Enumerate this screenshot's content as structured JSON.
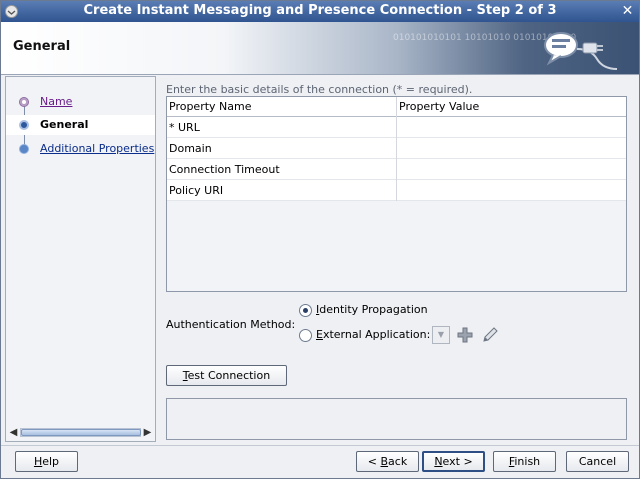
{
  "window": {
    "title": "Create Instant Messaging and Presence Connection - Step 2 of 3",
    "close_glyph": "✕"
  },
  "banner": {
    "heading": "General",
    "decoration_text": "010101010101 10101010 01010101010"
  },
  "nav": {
    "items": [
      {
        "label": "Name",
        "state": "visited"
      },
      {
        "label": "General",
        "state": "current"
      },
      {
        "label": "Additional Properties",
        "state": "link"
      }
    ]
  },
  "main": {
    "intro": "Enter the basic details of the connection (* = required).",
    "table": {
      "columns": [
        "Property Name",
        "Property Value"
      ],
      "rows": [
        {
          "name": "* URL",
          "value": ""
        },
        {
          "name": "Domain",
          "value": ""
        },
        {
          "name": "Connection Timeout",
          "value": ""
        },
        {
          "name": "Policy URI",
          "value": ""
        }
      ]
    },
    "auth": {
      "label": "Authentication Method:",
      "options": [
        {
          "label": "Identity Propagation",
          "mnemonic": "I",
          "rest": "dentity Propagation",
          "selected": true
        },
        {
          "label": "External Application:",
          "mnemonic": "E",
          "rest": "xternal Application:",
          "selected": false
        }
      ],
      "combo_value": ""
    },
    "test_button": {
      "mnemonic": "T",
      "rest": "est Connection"
    }
  },
  "footer": {
    "help": {
      "mnemonic": "H",
      "rest": "elp"
    },
    "back": {
      "pre": "< ",
      "mnemonic": "B",
      "rest": "ack"
    },
    "next": {
      "pre": "",
      "mnemonic": "N",
      "rest": "ext >"
    },
    "finish": {
      "mnemonic": "F",
      "rest": "inish"
    },
    "cancel": {
      "label": "Cancel"
    }
  },
  "colors": {
    "titlebar": "#3a5f9a",
    "link": "#0b2d8b",
    "visited_link": "#6a1d8a",
    "accent": "#2d5a9e"
  }
}
